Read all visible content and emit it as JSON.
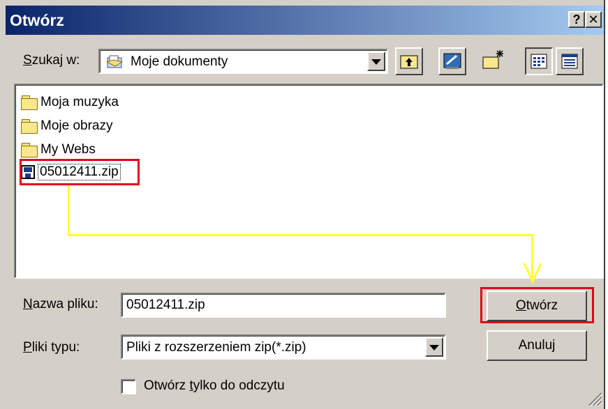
{
  "window": {
    "title": "Otwórz",
    "help_label": "?",
    "close_label": "✕"
  },
  "lookin": {
    "label_u": "S",
    "label_rest": "zukaj w:",
    "value": "Moje dokumenty",
    "icon": "my-documents-icon"
  },
  "toolbar": {
    "buttons": [
      "up-one-level-icon",
      "desktop-icon",
      "new-folder-icon",
      "list-view-icon",
      "details-view-icon"
    ]
  },
  "files": [
    {
      "name": "Moja muzyka",
      "type": "folder"
    },
    {
      "name": "Moje obrazy",
      "type": "folder"
    },
    {
      "name": "My Webs",
      "type": "folder"
    },
    {
      "name": "05012411.zip",
      "type": "zip",
      "highlighted": true
    }
  ],
  "filename": {
    "label_u": "N",
    "label_rest": "azwa pliku:",
    "value": "05012411.zip"
  },
  "filetype": {
    "label_u": "P",
    "label_rest": "liki typu:",
    "value": "Pliki z rozszerzeniem zip(*.zip)"
  },
  "readonly": {
    "label_pre": "Otwórz ",
    "label_u": "t",
    "label_rest": "ylko do odczytu",
    "checked": false
  },
  "buttons": {
    "open_u": "O",
    "open_rest": "twórz",
    "cancel": "Anuluj"
  },
  "colors": {
    "highlight": "#e3001b",
    "arrow": "#ffff33",
    "title_start": "#0a246a",
    "title_end": "#a6caf0"
  }
}
